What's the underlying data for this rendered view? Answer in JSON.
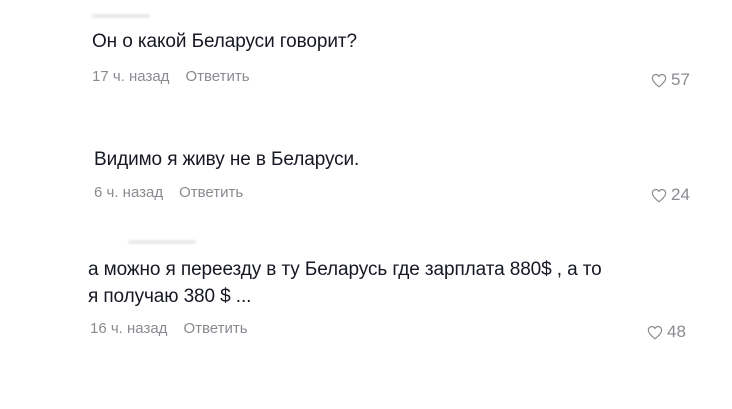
{
  "comments": [
    {
      "text": "Он о какой Беларуси говорит?",
      "time": "17 ч. назад",
      "reply_label": "Ответить",
      "likes": "57",
      "like_icon": "heart-outline-icon"
    },
    {
      "text": "Видимо я живу не в Беларуси.",
      "time": "6 ч. назад",
      "reply_label": "Ответить",
      "likes": "24",
      "like_icon": "heart-outline-icon"
    },
    {
      "text": "а можно я переезду в ту Беларусь где зарплата 880$ , а то\nя получаю 380 $ ...",
      "time": "16 ч. назад",
      "reply_label": "Ответить",
      "likes": "48",
      "like_icon": "heart-outline-icon"
    }
  ],
  "colors": {
    "text": "#161823",
    "meta": "#8a8b91",
    "background": "#ffffff"
  }
}
